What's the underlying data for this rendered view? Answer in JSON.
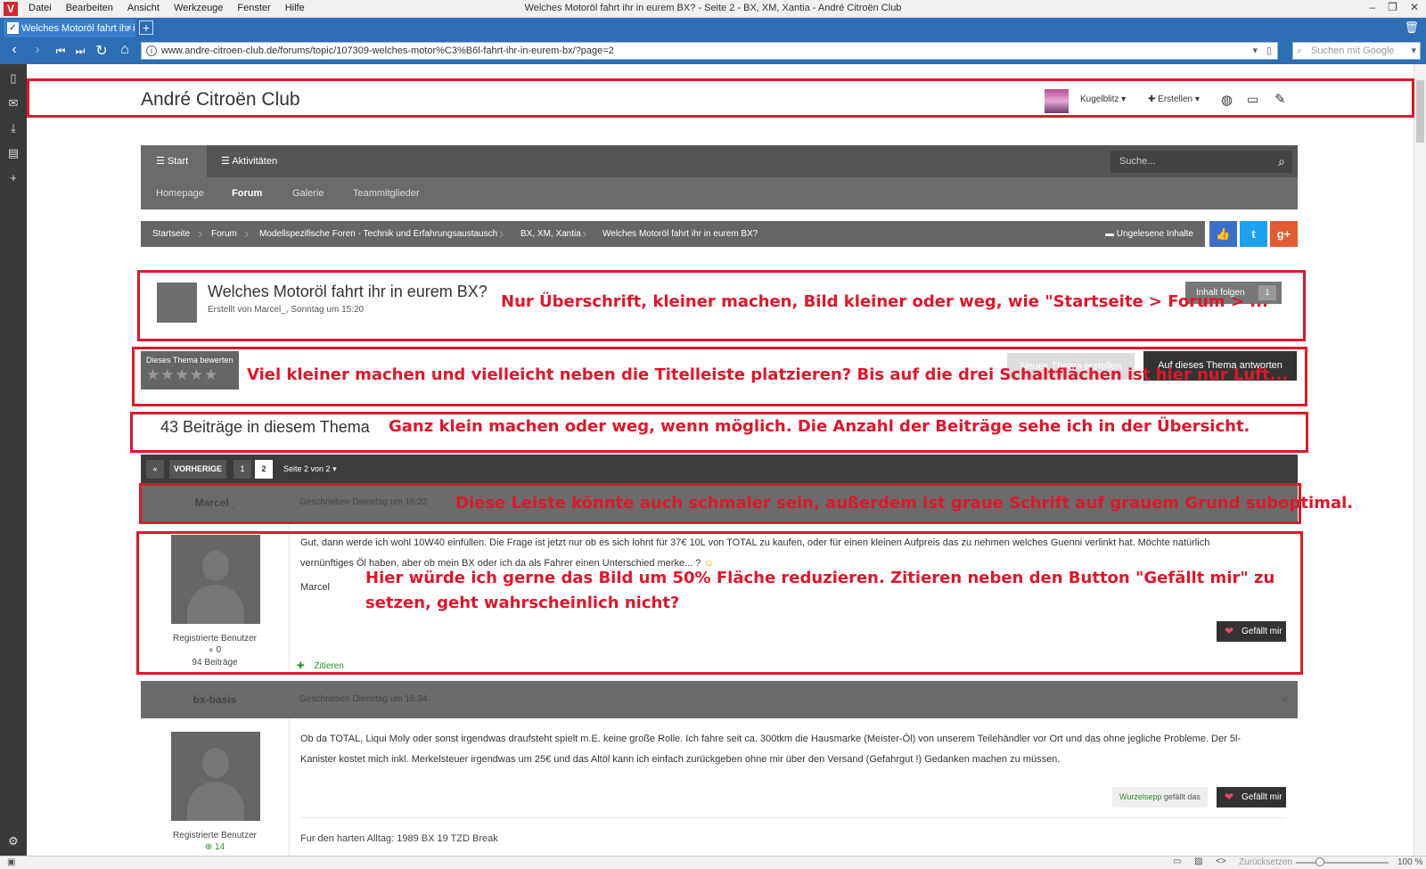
{
  "browser": {
    "menu_items": [
      "Datei",
      "Bearbeiten",
      "Ansicht",
      "Werkzeuge",
      "Fenster",
      "Hilfe"
    ],
    "window_title": "Welches Motoröl fahrt ihr in eurem BX? - Seite 2 - BX, XM, Xantia - André Citroën Club",
    "tab_label": "Welches Motoröl fahrt ihr i",
    "url": "www.andre-citroen-club.de/forums/topic/107309-welches-motor%C3%B6l-fahrt-ihr-in-eurem-bx/?page=2",
    "search_placeholder": "Suchen mit Google",
    "status_reset": "Zurücksetzen",
    "zoom": "100 %",
    "accent": "#2c6db5"
  },
  "site": {
    "title": "André Citroën Club",
    "user": "Kugelblitz",
    "create": "Erstellen"
  },
  "nav": {
    "start": "Start",
    "activities": "Aktivitäten",
    "search_placeholder": "Suche...",
    "sub": [
      "Homepage",
      "Forum",
      "Galerie",
      "Teammitglieder"
    ]
  },
  "breadcrumb": {
    "items": [
      "Startseite",
      "Forum",
      "Modellspezifische Foren - Technik und Erfahrungsaustausch",
      "BX, XM, Xantia",
      "Welches Motoröl fahrt ihr in eurem BX?"
    ],
    "unread": "Ungelesene Inhalte"
  },
  "topic": {
    "title": "Welches Motoröl fahrt ihr in eurem BX?",
    "meta": "Erstellt von Marcel_, Sonntag um 15:20",
    "follow": "Inhalt folgen",
    "follow_count": "1",
    "rate": "Dieses Thema bewerten",
    "stars": "★★★★★",
    "new_topic": "Neues Thema erstellen",
    "reply": "Auf dieses Thema antworten",
    "post_count": "43 Beiträge in diesem Thema"
  },
  "pagination": {
    "prev_icon": "«",
    "prev": "VORHERIGE",
    "pages": [
      "1",
      "2"
    ],
    "page_of": "Seite 2 von 2"
  },
  "posts": [
    {
      "author": "Marcel_",
      "date": "Geschrieben Dienstag um 16:22",
      "text1": "Gut, dann werde ich wohl 10W40 einfüllen. Die Frage ist jetzt nur ob es sich lohnt für 37€ 10L von TOTAL zu kaufen, oder für einen kleinen Aufpreis das zu nehmen welches Guenni verlinkt hat. Möchte natürlich",
      "text2": "vernünftiges Öl haben, aber ob mein BX oder ich da als Fahrer einen Unterschied merke... ?",
      "signoff": "Marcel",
      "role": "Registrierte Benutzer",
      "rep": "0",
      "posts": "94 Beiträge",
      "like": "Gefällt mir",
      "quote": "Zitieren"
    },
    {
      "author": "bx-basis",
      "date": "Geschrieben Dienstag um 16:34",
      "text1": "Ob da TOTAL, Liqui Moly oder sonst irgendwas draufsteht spielt m.E. keine große Rolle. Ich fahre seit ca. 300tkm die Hausmarke (Meister-Öl) von unserem Teilehändler vor Ort und das ohne jegliche Probleme. Der 5l-",
      "text2": "Kanister kostet mich inkl. Merkelsteuer irgendwas um 25€ und das Altöl kann ich einfach zurückgeben ohne mir über den Versand (Gefahrgut !) Gedanken machen zu müssen.",
      "liked_by": "Wurzelsepp",
      "liked_text": "gefällt das",
      "like": "Gefällt mir",
      "signature": "Fur den harten Alltag: 1989 BX 19 TZD Break",
      "role": "Registrierte Benutzer",
      "rep": "14"
    }
  ],
  "annotations": {
    "a1": "Nur Überschrift, kleiner machen, Bild kleiner oder weg, wie \"Startseite > Forum > ...",
    "a2": "Viel kleiner machen und vielleicht neben die Titelleiste platzieren? Bis auf die drei Schaltflächen ist hier nur Luft...",
    "a3": "Ganz klein machen oder weg, wenn möglich. Die Anzahl der Beiträge sehe ich in der Übersicht.",
    "a4": "Diese Leiste könnte auch schmaler sein, außerdem ist graue Schrift auf grauem Grund suboptimal.",
    "a5a": "Hier würde ich gerne das Bild um 50% Fläche reduzieren. Zitieren neben den Button \"Gefällt mir\" zu",
    "a5b": "setzen, geht wahrscheinlich nicht?",
    "color": "#e0162b"
  }
}
